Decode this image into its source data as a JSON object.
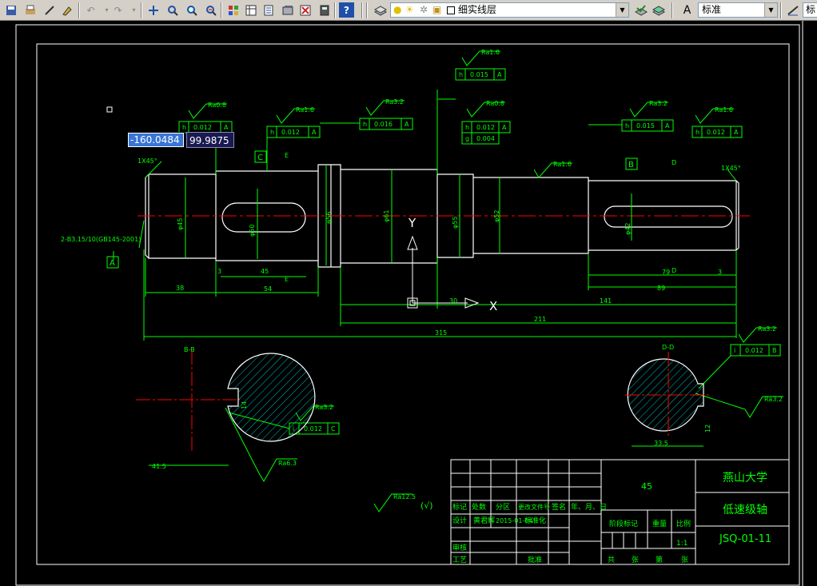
{
  "toolbar": {
    "layer_name": "细实线层",
    "text_style": "标准",
    "text_style_2": "标",
    "colors": {
      "bg": "#d4d0c8",
      "help": "#1f4fa8"
    }
  },
  "dyn_input": {
    "x_value": "-160.0484",
    "y_value": "99.9875"
  },
  "drawing": {
    "colors": {
      "line": "#00ff00",
      "center": "#ff0000",
      "white": "#ffffff",
      "hatch": "#00bbbb",
      "dim": "#00ff00"
    },
    "dims": {
      "d38": "38",
      "d54": "54",
      "d45": "45",
      "d3a": "3",
      "d79": "79",
      "d89": "89",
      "d3b": "3",
      "d30": "30",
      "d141": "141",
      "d211": "211",
      "d315": "315",
      "dia1": "φ45",
      "dia2": "φ50",
      "dia3": "φ56",
      "dia4": "φ61",
      "dia5": "φ55",
      "dia6": "φ52",
      "dia7": "φ42",
      "key1": "14",
      "key2": "12",
      "sec_bb": "41.5",
      "sec_dd": "33.5"
    },
    "chamfer_left": "1X45°",
    "chamfer_right": "1X45°",
    "center_hole": "2-B3.15/10(GB145-2001)",
    "section_bb": "B-B",
    "section_dd": "D-D",
    "labels": {
      "A": "A",
      "B": "B",
      "C": "C",
      "D": "D",
      "E": "E",
      "X": "X",
      "Y": "Y"
    },
    "rough": {
      "r1": "Ra0.8",
      "r2": "Ra1.6",
      "r3": "Ra3.2",
      "r4": "Ra1.6",
      "r5": "Ra0.8",
      "r6": "Ra3.2",
      "r7": "Ra1.6",
      "r8": "Ra1.6",
      "r9": "Ra3.2",
      "r10": "Ra3.2",
      "r11": "Ra6.3",
      "r12": "Ra3.2",
      "r13": "Ra12.5",
      "rest": "(√)"
    },
    "tol": {
      "t1": [
        "h",
        "0.012",
        "A"
      ],
      "t2": [
        "h",
        "0.012",
        "A"
      ],
      "t3": [
        "h",
        "0.016",
        "A"
      ],
      "t4": [
        "h",
        "0.015",
        "A"
      ],
      "t5": [
        "h",
        "0.012",
        "A"
      ],
      "t5b": [
        "g",
        "0.004",
        ""
      ],
      "t6": [
        "h",
        "0.015",
        "A"
      ],
      "t7": [
        "h",
        "0.012",
        "A"
      ],
      "t8": [
        "i",
        "0.012",
        "B"
      ],
      "t9": [
        "i",
        "0.012",
        "C"
      ]
    }
  },
  "title_block": {
    "material": "45",
    "school": "燕山大学",
    "part_name": "低速级轴",
    "drawing_no": "JSQ-01-11",
    "scale": "1:1",
    "h_mark": "标记",
    "h_count": "处数",
    "h_zone": "分区",
    "h_doc": "更改文件号",
    "h_sign": "签名",
    "h_date": "年、月、日",
    "design": "设计",
    "designer": "黄君辉",
    "date": "2015-01-04",
    "std": "标准化",
    "stage": "阶段标记",
    "weight": "重量",
    "ratio": "比例",
    "review": "审核",
    "process": "工艺",
    "approve": "批准",
    "sheets_total": "共",
    "sheets_unit": "张",
    "sheet_no": "第",
    "sheet_unit": "张"
  }
}
